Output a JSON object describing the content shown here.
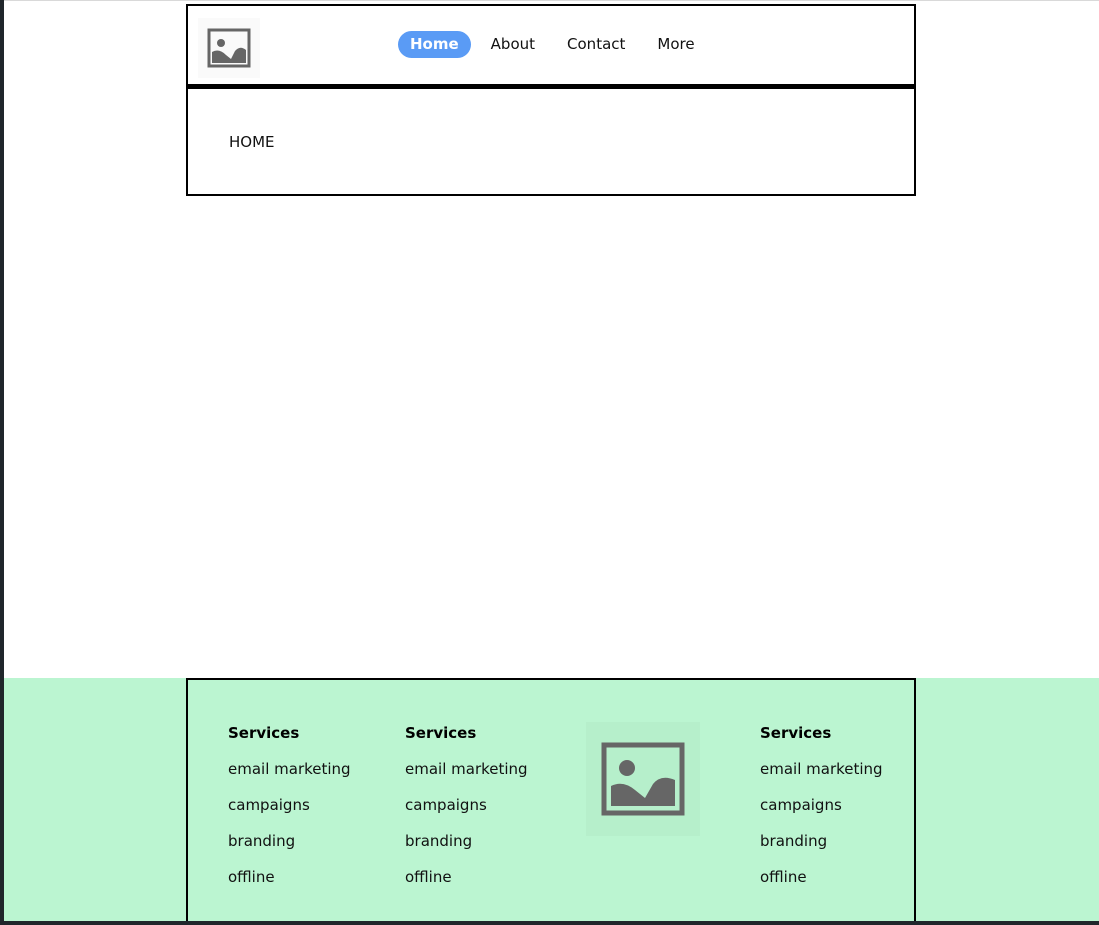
{
  "header": {
    "logo_icon": "image-placeholder-icon",
    "nav": [
      {
        "label": "Home",
        "active": true
      },
      {
        "label": "About",
        "active": false
      },
      {
        "label": "Contact",
        "active": false
      },
      {
        "label": "More",
        "active": false
      }
    ]
  },
  "main": {
    "page_label": "HOME"
  },
  "footer": {
    "columns": [
      {
        "heading": "Services",
        "links": [
          "email marketing",
          "campaigns",
          "branding",
          "offline"
        ]
      },
      {
        "heading": "Services",
        "links": [
          "email marketing",
          "campaigns",
          "branding",
          "offline"
        ]
      },
      {
        "heading": "Services",
        "links": [
          "email marketing",
          "campaigns",
          "branding",
          "offline"
        ]
      }
    ],
    "logo_icon": "image-placeholder-icon"
  },
  "colors": {
    "nav_active_bg": "#5a9bf5",
    "footer_bg": "#bbf5d1",
    "placeholder_gray": "#666666"
  }
}
